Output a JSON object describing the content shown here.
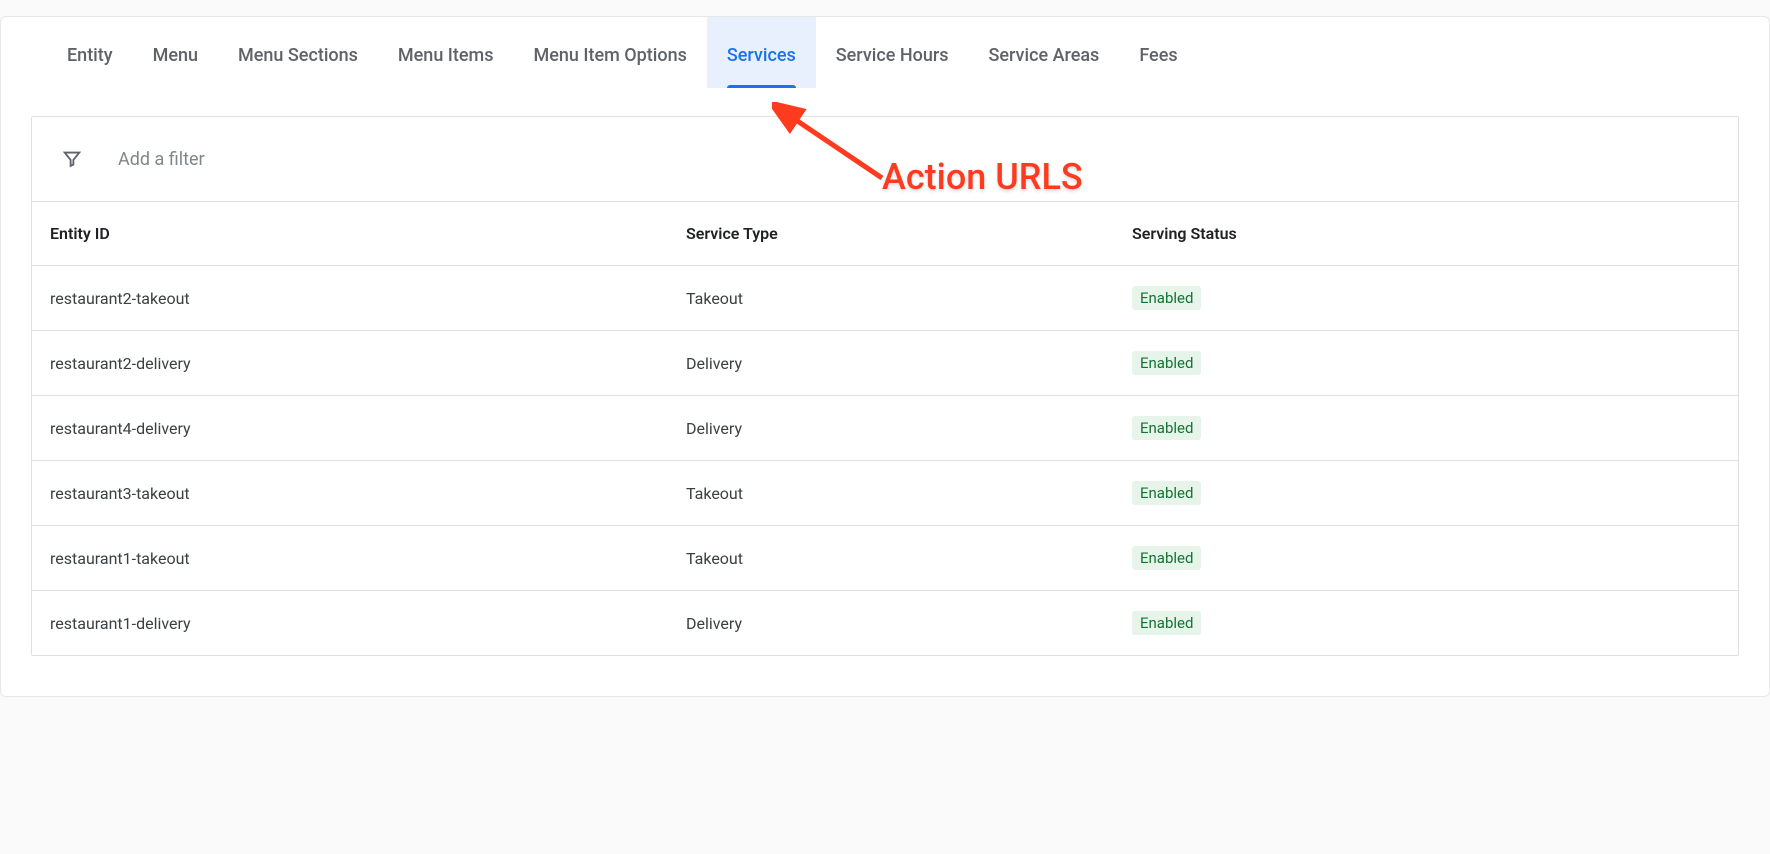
{
  "tabs": [
    {
      "label": "Entity",
      "active": false
    },
    {
      "label": "Menu",
      "active": false
    },
    {
      "label": "Menu Sections",
      "active": false
    },
    {
      "label": "Menu Items",
      "active": false
    },
    {
      "label": "Menu Item Options",
      "active": false
    },
    {
      "label": "Services",
      "active": true
    },
    {
      "label": "Service Hours",
      "active": false
    },
    {
      "label": "Service Areas",
      "active": false
    },
    {
      "label": "Fees",
      "active": false
    }
  ],
  "filter": {
    "placeholder": "Add a filter"
  },
  "table": {
    "headers": {
      "entity_id": "Entity ID",
      "service_type": "Service Type",
      "serving_status": "Serving Status"
    },
    "rows": [
      {
        "entity_id": "restaurant2-takeout",
        "service_type": "Takeout",
        "serving_status": "Enabled"
      },
      {
        "entity_id": "restaurant2-delivery",
        "service_type": "Delivery",
        "serving_status": "Enabled"
      },
      {
        "entity_id": "restaurant4-delivery",
        "service_type": "Delivery",
        "serving_status": "Enabled"
      },
      {
        "entity_id": "restaurant3-takeout",
        "service_type": "Takeout",
        "serving_status": "Enabled"
      },
      {
        "entity_id": "restaurant1-takeout",
        "service_type": "Takeout",
        "serving_status": "Enabled"
      },
      {
        "entity_id": "restaurant1-delivery",
        "service_type": "Delivery",
        "serving_status": "Enabled"
      }
    ]
  },
  "annotation": {
    "text": "Action URLS"
  }
}
